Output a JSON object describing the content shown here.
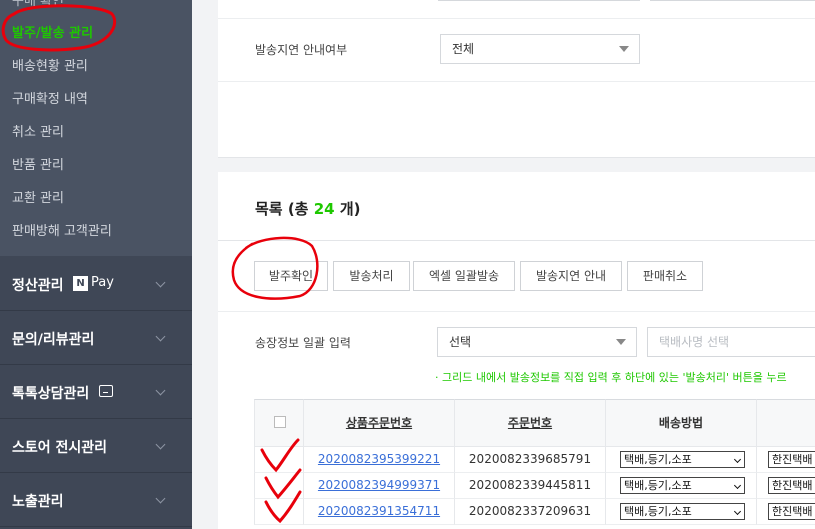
{
  "sidebar": {
    "top_partial": "구매 확인",
    "sub_items": [
      {
        "label": "발주/발송 관리",
        "active": true
      },
      {
        "label": "배송현황 관리"
      },
      {
        "label": "구매확정 내역"
      },
      {
        "label": "취소 관리"
      },
      {
        "label": "반품 관리"
      },
      {
        "label": "교환 관리"
      },
      {
        "label": "판매방해 고객관리"
      }
    ],
    "groups": [
      {
        "label": "정산관리",
        "badge": "N",
        "badge_text": "Pay"
      },
      {
        "label": "문의/리뷰관리"
      },
      {
        "label": "톡톡상담관리"
      },
      {
        "label": "스토어 전시관리"
      },
      {
        "label": "노출관리"
      }
    ]
  },
  "filter": {
    "delay_label": "발송지연 안내여부",
    "delay_value": "전체"
  },
  "list": {
    "title_prefix": "목록 (총",
    "count": "24",
    "title_suffix": "개)",
    "buttons": [
      "발주확인",
      "발송처리",
      "엑셀 일괄발송",
      "발송지연 안내",
      "판매취소"
    ],
    "bulk_label": "송장정보 일괄 입력",
    "bulk_select_value": "선택",
    "courier_placeholder": "택배사명 선택",
    "notice": "· 그리드 내에서 발송정보를 직접 입력 후 하단에 있는 '발송처리' 버튼을 누르"
  },
  "table": {
    "headers": [
      "상품주문번호",
      "주문번호",
      "배송방법"
    ],
    "rows": [
      {
        "product_order": "2020082395399221",
        "order": "2020082339685791",
        "method": "택배,등기,소포",
        "courier": "한진택배"
      },
      {
        "product_order": "2020082394999371",
        "order": "2020082339445811",
        "method": "택배,등기,소포",
        "courier": "한진택배"
      },
      {
        "product_order": "2020082391354711",
        "order": "2020082337209631",
        "method": "택배,등기,소포",
        "courier": "한진택배"
      }
    ]
  },
  "colors": {
    "sidebar_bg": "#3f4756",
    "accent_green": "#1ec800",
    "link_blue": "#3a6fd8",
    "annotation_red": "#e8000b"
  }
}
